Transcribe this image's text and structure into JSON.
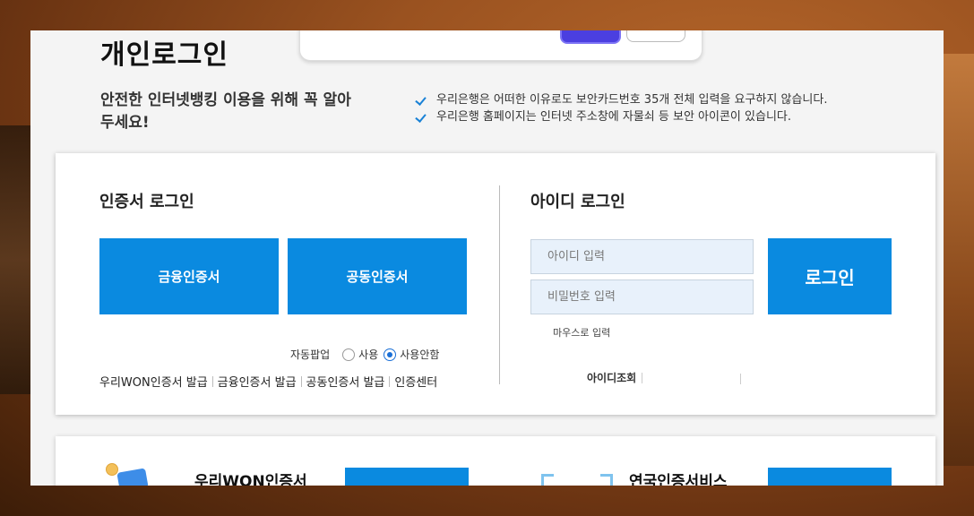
{
  "page": {
    "title": "개인로그인"
  },
  "notice": {
    "title": "안전한 인터넷뱅킹 이용을 위해 꼭 알아두세요!",
    "items": [
      "우리은행은 어떠한 이유로도 보안카드번호 35개 전체 입력을 요구하지 않습니다.",
      "우리은행 홈페이지는 인터넷 주소창에 자물쇠 등 보안 아이콘이 있습니다."
    ]
  },
  "cert_login": {
    "title": "인증서 로그인",
    "financial_cert_label": "금융인증서",
    "public_cert_label": "공동인증서",
    "auto_popup": {
      "label": "자동팝업",
      "options": [
        "사용",
        "사용안함"
      ],
      "selected": "사용안함"
    },
    "links": [
      "우리WON인증서 발급",
      "금융인증서 발급",
      "공동인증서 발급",
      "인증센터"
    ]
  },
  "id_login": {
    "title": "아이디 로그인",
    "id_placeholder": "아이디 입력",
    "pw_placeholder": "비밀번호 입력",
    "mouse_input_label": "마우스로 입력",
    "login_label": "로그인",
    "links": [
      "아이디조회"
    ]
  },
  "lower": {
    "won_title": "우리WON인증서",
    "joint_title": "연국인증서비스"
  },
  "colors": {
    "primary": "#0a8ae0",
    "check": "#1a82d6"
  }
}
